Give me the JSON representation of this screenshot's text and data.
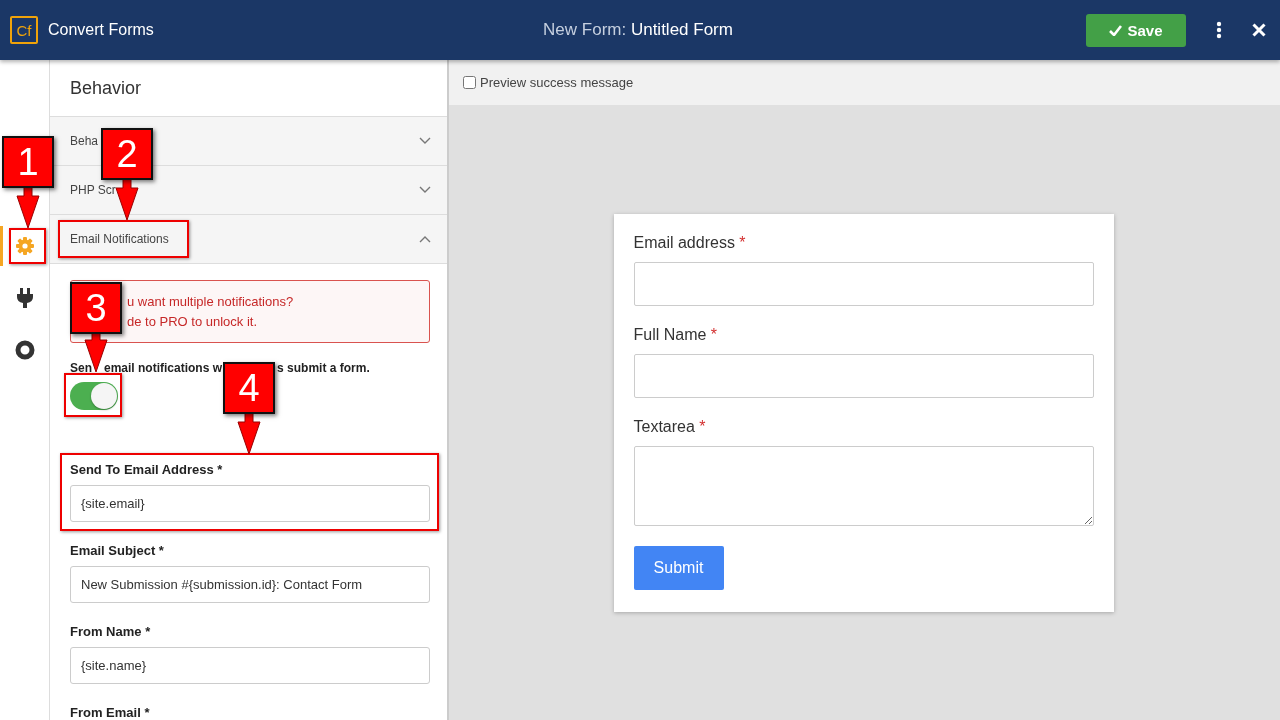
{
  "header": {
    "logo": "Cf",
    "app_name": "Convert Forms",
    "title_prefix": "New Form:",
    "title": "Untitled Form",
    "save_label": "Save"
  },
  "rail": [
    {
      "kind": "gear",
      "selected": true
    },
    {
      "kind": "plug",
      "selected": false
    },
    {
      "kind": "disc",
      "selected": false
    }
  ],
  "panel": {
    "title": "Behavior",
    "sections": [
      {
        "label": "Beha",
        "expanded": false
      },
      {
        "label": "PHP Scr",
        "expanded": false
      },
      {
        "label": "Email Notifications",
        "expanded": true
      }
    ],
    "alert_lines": [
      "u want multiple notifications?",
      "de to PRO to unlock it."
    ],
    "toggle_label_parts": [
      "Sen",
      "email notifications w",
      "s submit a form."
    ],
    "toggle_on": true,
    "fields": [
      {
        "label": "Send To Email Address *",
        "value": "{site.email}"
      },
      {
        "label": "Email Subject *",
        "value": "New Submission #{submission.id}: Contact Form"
      },
      {
        "label": "From Name *",
        "value": "{site.name}"
      },
      {
        "label": "From Email *"
      }
    ]
  },
  "preview": {
    "checkbox_label": "Preview success message",
    "checked": false,
    "form_fields": [
      {
        "label": "Email address",
        "required": "*",
        "kind": "input"
      },
      {
        "label": "Full Name",
        "required": "*",
        "kind": "input"
      },
      {
        "label": "Textarea",
        "required": "*",
        "kind": "textarea"
      }
    ],
    "submit_label": "Submit"
  },
  "annotations": [
    {
      "number": "1"
    },
    {
      "number": "2"
    },
    {
      "number": "3"
    },
    {
      "number": "4"
    }
  ]
}
